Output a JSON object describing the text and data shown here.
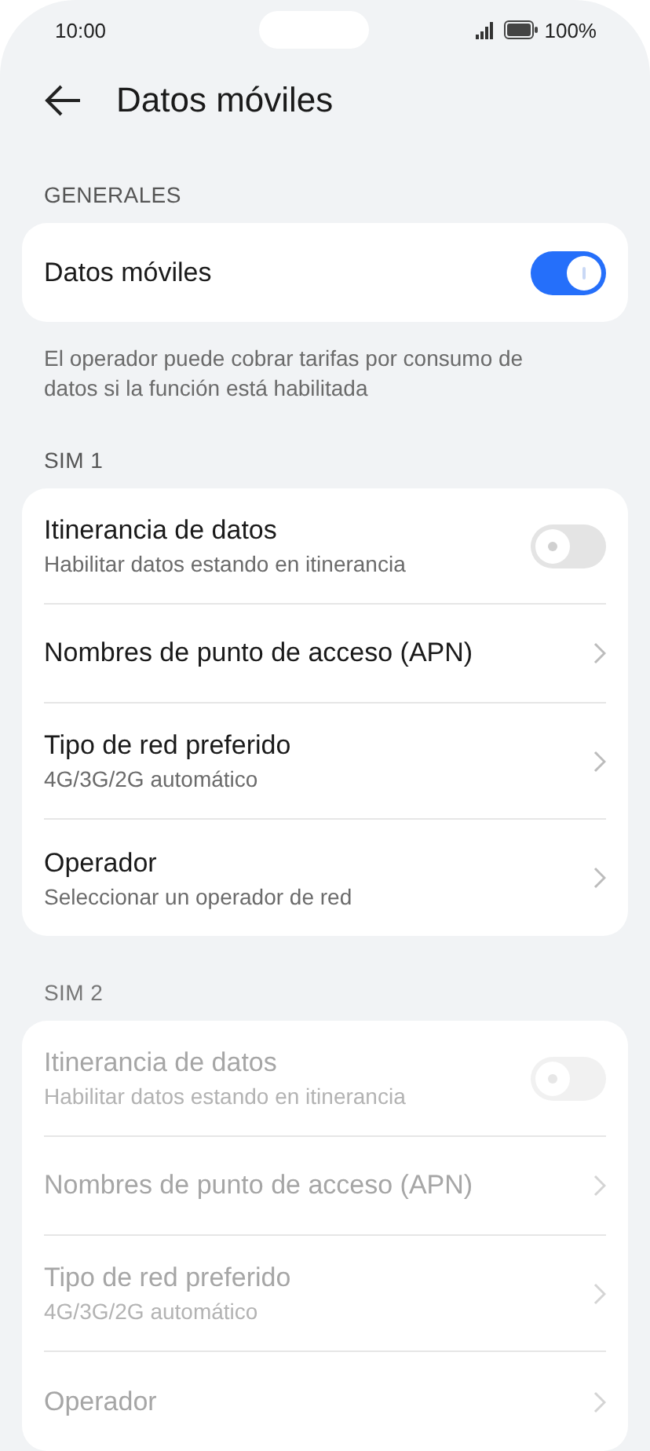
{
  "status_bar": {
    "time": "10:00",
    "battery": "100%"
  },
  "header": {
    "title": "Datos móviles"
  },
  "sections": [
    {
      "heading": "GENERALES",
      "disabled": false,
      "rows": [
        {
          "kind": "toggle",
          "title": "Datos móviles",
          "on": true
        }
      ],
      "note": "El operador puede cobrar tarifas por consumo de datos si la función está habilitada"
    },
    {
      "heading": "SIM 1",
      "disabled": false,
      "rows": [
        {
          "kind": "toggle",
          "title": "Itinerancia de datos",
          "subtitle": "Habilitar datos estando en itinerancia",
          "on": false
        },
        {
          "kind": "link",
          "title": "Nombres de punto de acceso (APN)"
        },
        {
          "kind": "link",
          "title": "Tipo de red preferido",
          "subtitle": "4G/3G/2G automático"
        },
        {
          "kind": "link",
          "title": "Operador",
          "subtitle": "Seleccionar un operador de red"
        }
      ]
    },
    {
      "heading": "SIM 2",
      "disabled": true,
      "rows": [
        {
          "kind": "toggle",
          "title": "Itinerancia de datos",
          "subtitle": "Habilitar datos estando en itinerancia",
          "on": false
        },
        {
          "kind": "link",
          "title": "Nombres de punto de acceso (APN)"
        },
        {
          "kind": "link",
          "title": "Tipo de red preferido",
          "subtitle": "4G/3G/2G automático"
        },
        {
          "kind": "link",
          "title": "Operador"
        }
      ]
    }
  ]
}
